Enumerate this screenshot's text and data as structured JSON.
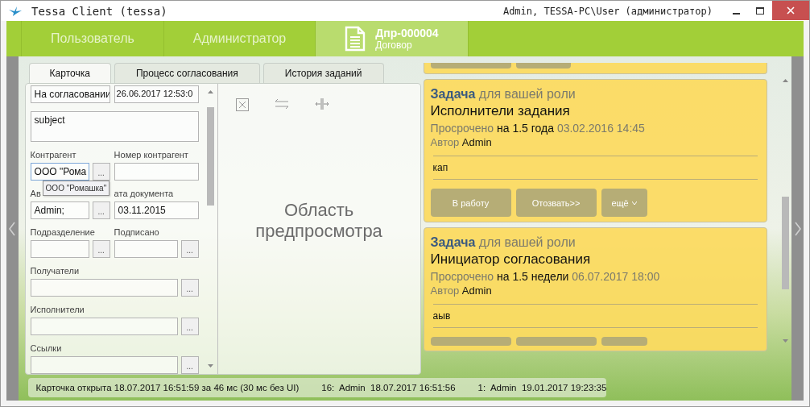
{
  "window": {
    "title": "Tessa Client (tessa)",
    "user_info": "Admin, TESSA-PC\\User (администратор)"
  },
  "nav_tabs": [
    {
      "kind": "text",
      "label": "Пользователь",
      "selected": false
    },
    {
      "kind": "text",
      "label": "Администратор",
      "selected": false
    },
    {
      "kind": "document",
      "label": "Дпр-000004",
      "sublabel": "Договор",
      "selected": true
    }
  ],
  "card_tabs": [
    {
      "label": "Карточка",
      "selected": true
    },
    {
      "label": "Процесс согласования",
      "selected": false
    },
    {
      "label": "История заданий",
      "selected": false
    }
  ],
  "form": {
    "rows": [
      {
        "cells": [
          {
            "kind": "text",
            "value": "На согласовании"
          },
          {
            "kind": "text",
            "value": "26.06.2017  12:53:0"
          }
        ]
      },
      {
        "cells": [
          {
            "kind": "memo",
            "value": "subject"
          }
        ]
      },
      {
        "cells": [
          {
            "kind": "picker",
            "label": "Контрагент",
            "value": "ООО \"Рома",
            "button": "..."
          },
          {
            "kind": "text",
            "label": "Номер контрагент"
          }
        ]
      },
      {
        "cells": [
          {
            "kind": "picker",
            "label": "Ав",
            "value": "Admin;",
            "button": "..."
          },
          {
            "kind": "date",
            "label": "ата документа",
            "value": "03.11.2015"
          }
        ]
      },
      {
        "cells": [
          {
            "kind": "picker",
            "label": "Подразделение",
            "button": "..."
          },
          {
            "kind": "picker",
            "label": "Подписано",
            "button": "..."
          }
        ]
      },
      {
        "cells": [
          {
            "kind": "picker",
            "label": "Получатели",
            "button": "..."
          }
        ]
      },
      {
        "cells": [
          {
            "kind": "picker",
            "label": "Исполнители",
            "button": "..."
          }
        ]
      },
      {
        "cells": [
          {
            "kind": "picker",
            "label": "Ссылки",
            "button": "..."
          }
        ]
      }
    ],
    "tooltip": "ООО \"Ромашка\""
  },
  "preview": {
    "text": "Область предпросмотра"
  },
  "tasks": [
    {
      "kind": "partial",
      "buttons": [
        {
          "kind": "stub"
        },
        {
          "kind": "stub"
        }
      ]
    },
    {
      "kind": "full",
      "type_label": "Задача",
      "role": "для вашей роли",
      "title": "Исполнители задания",
      "overdue_label": "Просрочено",
      "overdue_value": "на 1.5 года",
      "date": "03.02.2016 14:45",
      "author_label": "Автор",
      "author": "Admin",
      "comment": "кап",
      "buttons": [
        {
          "kind": "label",
          "label": "В работу"
        },
        {
          "kind": "label",
          "label": "Отозвать>>"
        },
        {
          "kind": "menu",
          "label": "ещё"
        }
      ]
    },
    {
      "kind": "full",
      "type_label": "Задача",
      "role": "для вашей роли",
      "title": "Инициатор согласования",
      "overdue_label": "Просрочено",
      "overdue_value": "на 1.5 недели",
      "date": "06.07.2017 18:00",
      "author_label": "Автор",
      "author": "Admin",
      "comment": "аыв",
      "buttons": [
        {
          "kind": "stub"
        },
        {
          "kind": "stub"
        },
        {
          "kind": "stub"
        }
      ]
    }
  ],
  "status_bar": [
    "Карточка открыта 18.07.2017 16:51:59 за 46 мс (30 мс без UI)",
    "16:  Admin  18.07.2017 16:51:56",
    "1:  Admin  19.01.2017 19:23:35"
  ]
}
